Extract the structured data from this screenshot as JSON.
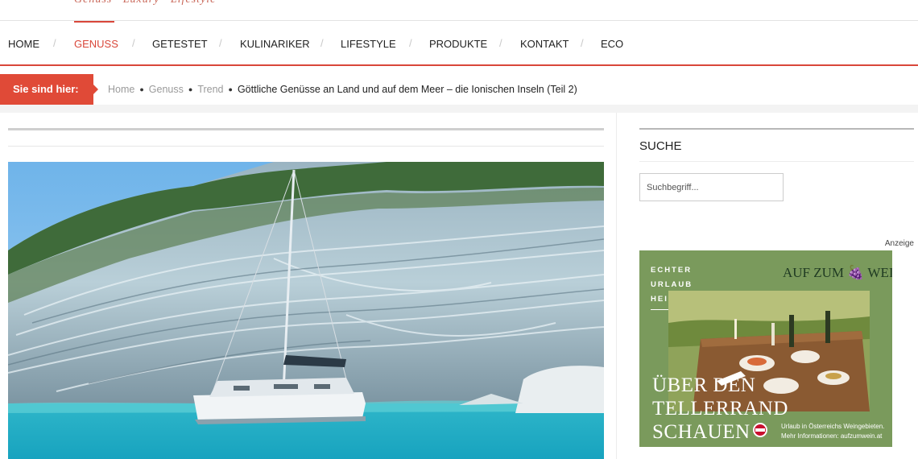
{
  "header": {
    "tagline": "Genuss · Luxury · Lifestyle"
  },
  "nav": {
    "items": [
      {
        "label": "HOME"
      },
      {
        "label": "GENUSS",
        "active": true
      },
      {
        "label": "GETESTET"
      },
      {
        "label": "KULINARIKER"
      },
      {
        "label": "LIFESTYLE"
      },
      {
        "label": "PRODUKTE"
      },
      {
        "label": "KONTAKT"
      },
      {
        "label": "ECO"
      }
    ],
    "separator": "/",
    "accent_color": "#d9473a"
  },
  "breadcrumb": {
    "label": "Sie sind hier:",
    "trail": [
      "Home",
      "Genuss",
      "Trend"
    ],
    "current": "Göttliche Genüsse an Land und auf dem Meer – die Ionischen Inseln (Teil 2)",
    "separator": "●"
  },
  "hero": {
    "icon": "photo-sailboat-cliff"
  },
  "sidebar": {
    "search": {
      "title": "SUCHE",
      "placeholder": "Suchbegriff..."
    },
    "ad": {
      "label": "Anzeige",
      "kicker": [
        "ECHTER",
        "URLAUB",
        "HEISST:"
      ],
      "brand": "AUF ZUM 🍇 WEIN",
      "headline": [
        "ÜBER DEN",
        "TELLERRAND",
        "SCHAUEN"
      ],
      "smalltext": [
        "Urlaub in Österreichs Weingebieten.",
        "Mehr Informationen: aufzumwein.at"
      ],
      "background": "#7a9a5c"
    }
  }
}
